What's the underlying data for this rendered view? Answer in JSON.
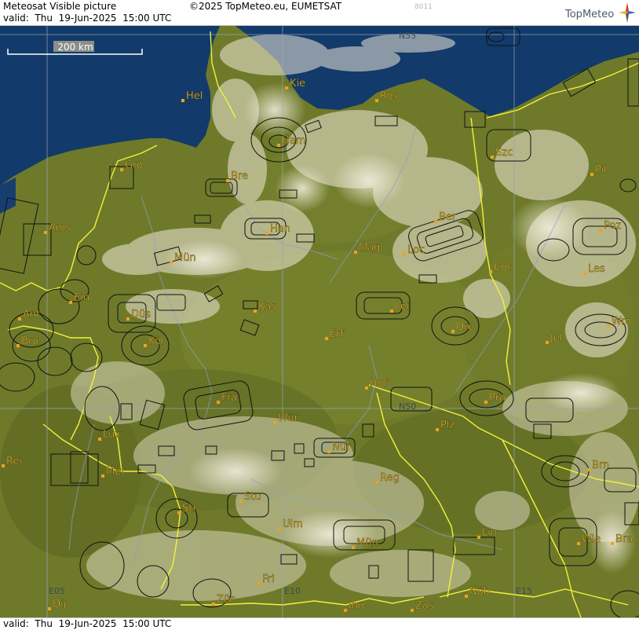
{
  "header": {
    "product_title": "Meteosat Visible picture",
    "copyright": "©2025 TopMeteo.eu, EUMETSAT",
    "image_code": "8011",
    "valid_line": "valid:  Thu  19-Jun-2025  15:00 UTC",
    "brand": "TopMeteo"
  },
  "footer": {
    "valid_line": "valid:  Thu  19-Jun-2025  15:00 UTC"
  },
  "scale_bar": {
    "label": "200 km"
  },
  "graticule_labels": [
    "N55",
    "N50",
    "E05",
    "E10",
    "E15"
  ],
  "cities": [
    {
      "code": "Hel"
    },
    {
      "code": "Kie"
    },
    {
      "code": "Ros"
    },
    {
      "code": "Ham"
    },
    {
      "code": "Szc"
    },
    {
      "code": "Gro"
    },
    {
      "code": "Bre"
    },
    {
      "code": "Pil"
    },
    {
      "code": "Ber"
    },
    {
      "code": "Ams"
    },
    {
      "code": "Han"
    },
    {
      "code": "Poz"
    },
    {
      "code": "Mag"
    },
    {
      "code": "Loc"
    },
    {
      "code": "Mün"
    },
    {
      "code": "Cot"
    },
    {
      "code": "Les"
    },
    {
      "code": "Ein"
    },
    {
      "code": "Kas"
    },
    {
      "code": "Lei"
    },
    {
      "code": "Ant"
    },
    {
      "code": "Düs"
    },
    {
      "code": "Dre"
    },
    {
      "code": "Wro"
    },
    {
      "code": "Bru"
    },
    {
      "code": "Köl"
    },
    {
      "code": "Erf"
    },
    {
      "code": "Jel"
    },
    {
      "code": "Hof"
    },
    {
      "code": "Fra"
    },
    {
      "code": "Pra"
    },
    {
      "code": "Wür"
    },
    {
      "code": "Plz"
    },
    {
      "code": "Lux"
    },
    {
      "code": "Nür"
    },
    {
      "code": "Rei"
    },
    {
      "code": "Met"
    },
    {
      "code": "Reg"
    },
    {
      "code": "Brn"
    },
    {
      "code": "Stu"
    },
    {
      "code": "Str"
    },
    {
      "code": "Ulm"
    },
    {
      "code": "Lin"
    },
    {
      "code": "Mün"
    },
    {
      "code": "Wie"
    },
    {
      "code": "Bra"
    },
    {
      "code": "Fri"
    },
    {
      "code": "Dij"
    },
    {
      "code": "Zür"
    },
    {
      "code": "Nöb"
    },
    {
      "code": "Inn"
    },
    {
      "code": "Zas"
    }
  ],
  "colors": {
    "sea": "#123a6a",
    "land": "#6e7a2a",
    "border": "#f2f23a",
    "city_label": "#f0b830",
    "city_dot": "#f0a020",
    "graticule_label": "#3a4a55",
    "brand_text": "#4a5a68"
  }
}
